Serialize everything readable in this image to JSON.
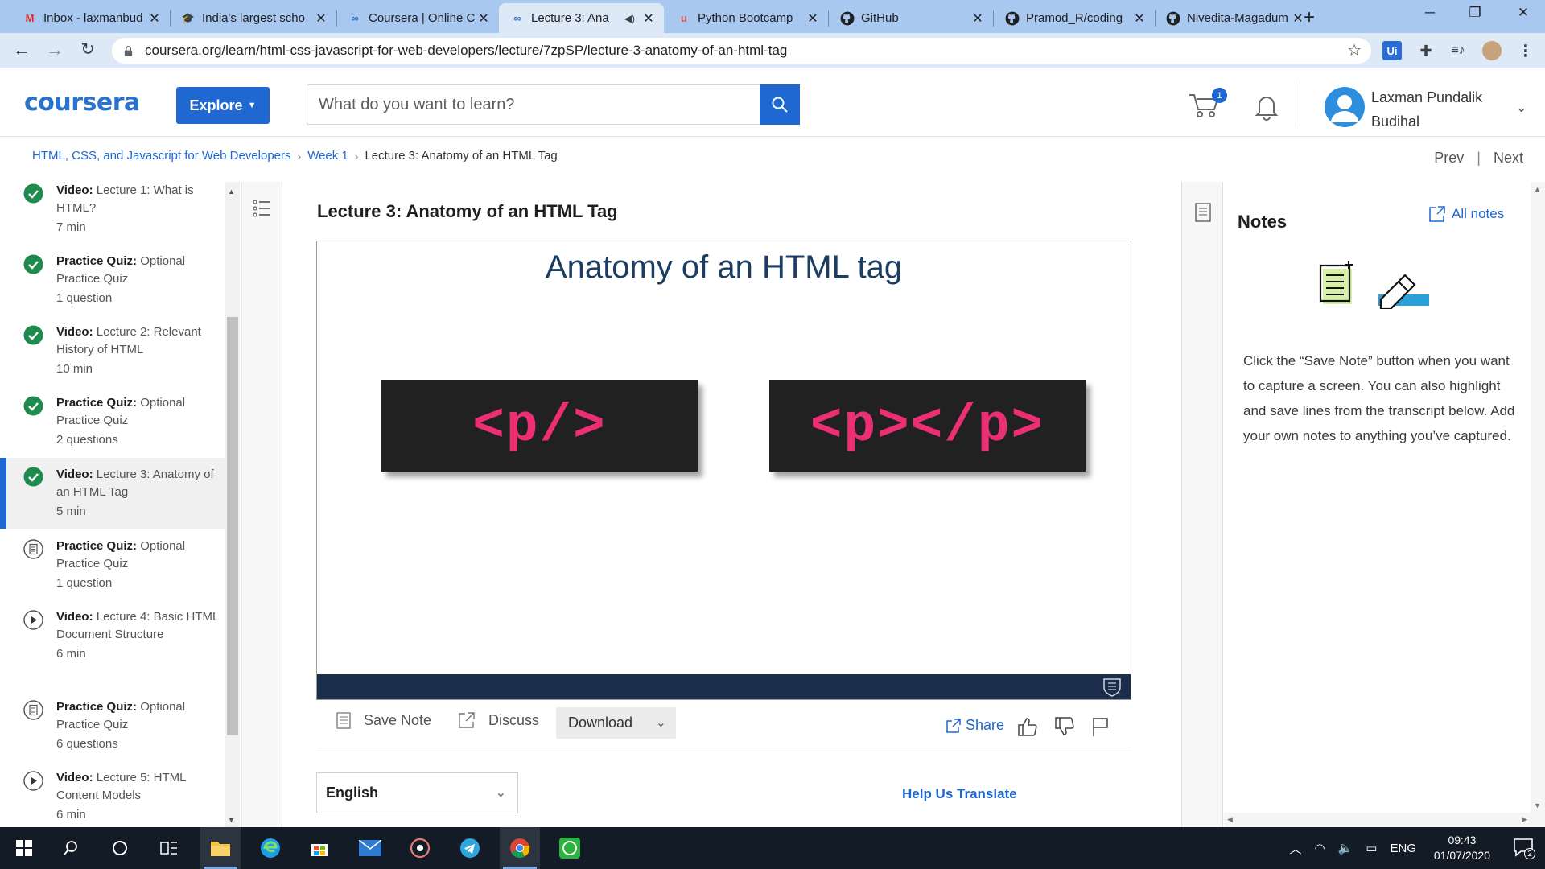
{
  "browser": {
    "tabs": [
      {
        "title": "Inbox - laxmanbud",
        "favicon": "gmail-icon",
        "active": false
      },
      {
        "title": "India's largest scho",
        "favicon": "school-icon",
        "active": false
      },
      {
        "title": "Coursera | Online C",
        "favicon": "coursera-icon",
        "active": false
      },
      {
        "title": "Lecture 3: Ana",
        "favicon": "coursera-icon",
        "active": true,
        "audio": true
      },
      {
        "title": "Python Bootcamp",
        "favicon": "udemy-icon",
        "active": false
      },
      {
        "title": "GitHub",
        "favicon": "github-icon",
        "active": false
      },
      {
        "title": "Pramod_R/coding",
        "favicon": "github-icon",
        "active": false
      },
      {
        "title": "Nivedita-Magadum",
        "favicon": "github-icon",
        "active": false
      }
    ],
    "url": "coursera.org/learn/html-css-javascript-for-web-developers/lecture/7zpSP/lecture-3-anatomy-of-an-html-tag",
    "extensions": [
      "uipath-icon",
      "puzzle-icon",
      "media-control-icon",
      "profile-avatar-icon"
    ]
  },
  "header": {
    "logo": "coursera",
    "explore_label": "Explore",
    "search_placeholder": "What do you want to learn?",
    "cart_count": "1",
    "user_name": "Laxman Pundalik Budihal"
  },
  "breadcrumb": {
    "course": "HTML, CSS, and Javascript for Web Developers",
    "week": "Week 1",
    "lecture": "Lecture 3: Anatomy of an HTML Tag",
    "prev": "Prev",
    "next": "Next"
  },
  "syllabus": [
    {
      "kind": "Video:",
      "title": "Lecture 1: What is HTML?",
      "detail": "7 min",
      "status": "done"
    },
    {
      "kind": "Practice Quiz:",
      "title": "Optional Practice Quiz",
      "detail": "1 question",
      "status": "done"
    },
    {
      "kind": "Video:",
      "title": "Lecture 2: Relevant History of HTML",
      "detail": "10 min",
      "status": "done"
    },
    {
      "kind": "Practice Quiz:",
      "title": "Optional Practice Quiz",
      "detail": "2 questions",
      "status": "done"
    },
    {
      "kind": "Video:",
      "title": "Lecture 3: Anatomy of an HTML Tag",
      "detail": "5 min",
      "status": "done",
      "current": true
    },
    {
      "kind": "Practice Quiz:",
      "title": "Optional Practice Quiz",
      "detail": "1 question",
      "status": "quiz"
    },
    {
      "kind": "Video:",
      "title": "Lecture 4: Basic HTML Document Structure",
      "detail": "6 min",
      "status": "video"
    },
    {
      "kind": "Practice Quiz:",
      "title": "Optional Practice Quiz",
      "detail": "6 questions",
      "status": "quiz"
    },
    {
      "kind": "Video:",
      "title": "Lecture 5: HTML Content Models",
      "detail": "6 min",
      "status": "video"
    }
  ],
  "main": {
    "title": "Lecture 3: Anatomy of an HTML Tag",
    "slide": {
      "title": "Anatomy of an HTML tag",
      "code_left": "<p/>",
      "code_right": "<p></p>"
    },
    "actions": {
      "save_note": "Save Note",
      "discuss": "Discuss",
      "download": "Download",
      "share": "Share"
    },
    "language": "English",
    "help_translate": "Help Us Translate"
  },
  "notes": {
    "title": "Notes",
    "all_notes": "All notes",
    "help_text": "Click the “Save Note” button when you want to capture a screen. You can also highlight and save lines from the transcript below. Add your own notes to anything you’ve captured."
  },
  "taskbar": {
    "time": "09:43",
    "date": "01/07/2020",
    "language": "ENG",
    "notification_count": "2"
  },
  "colors": {
    "brand_blue": "#1f67d1",
    "slide_code": "#ec2f73",
    "done_green": "#1e8a4c",
    "tab_strip": "#a9c8ef"
  }
}
